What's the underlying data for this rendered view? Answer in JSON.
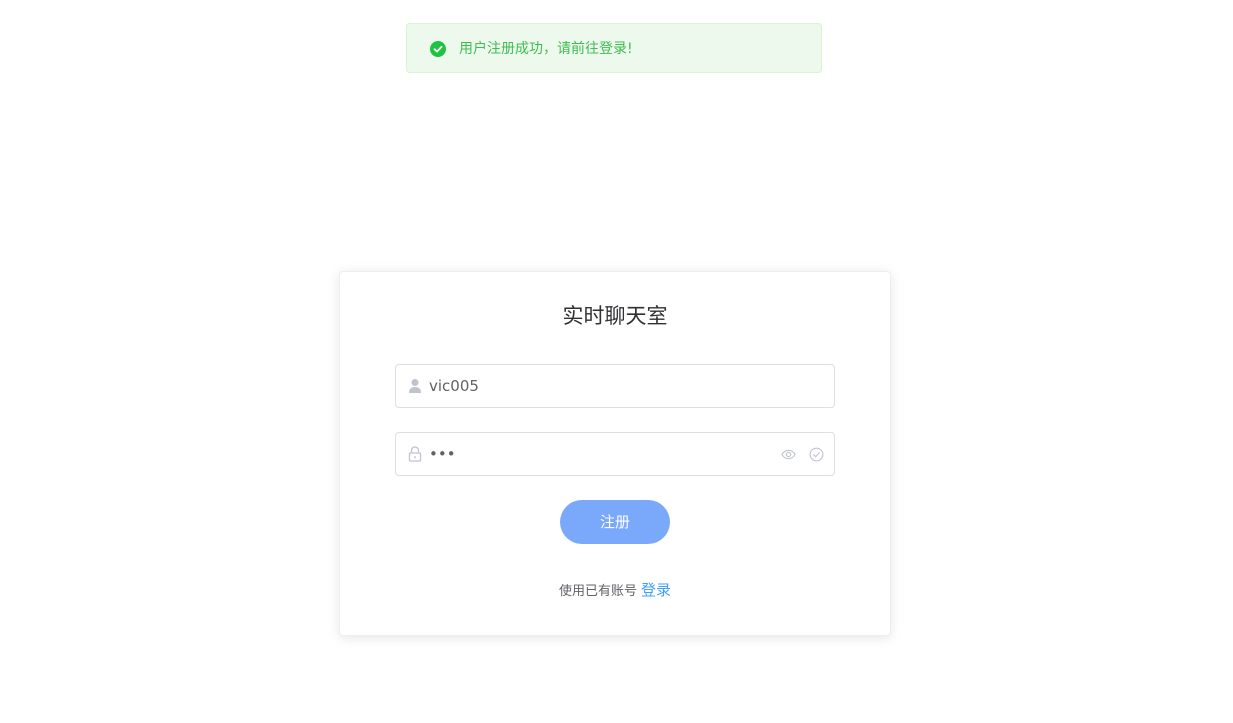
{
  "toast": {
    "icon": "success-check-icon",
    "message": "用户注册成功，请前往登录!",
    "color": "#3fbd52",
    "background": "#edf9ec"
  },
  "card": {
    "title": "实时聊天室",
    "username": {
      "icon": "user-icon",
      "value": "vic005"
    },
    "password": {
      "icon": "lock-icon",
      "value": "•••",
      "suffix_icons": [
        "eye-icon",
        "circle-check-icon"
      ]
    },
    "register_button": {
      "label": "注册",
      "color": "#7aa9fb"
    },
    "footer": {
      "text": "使用已有账号",
      "link_label": "登录",
      "link_color": "#409eff"
    }
  }
}
